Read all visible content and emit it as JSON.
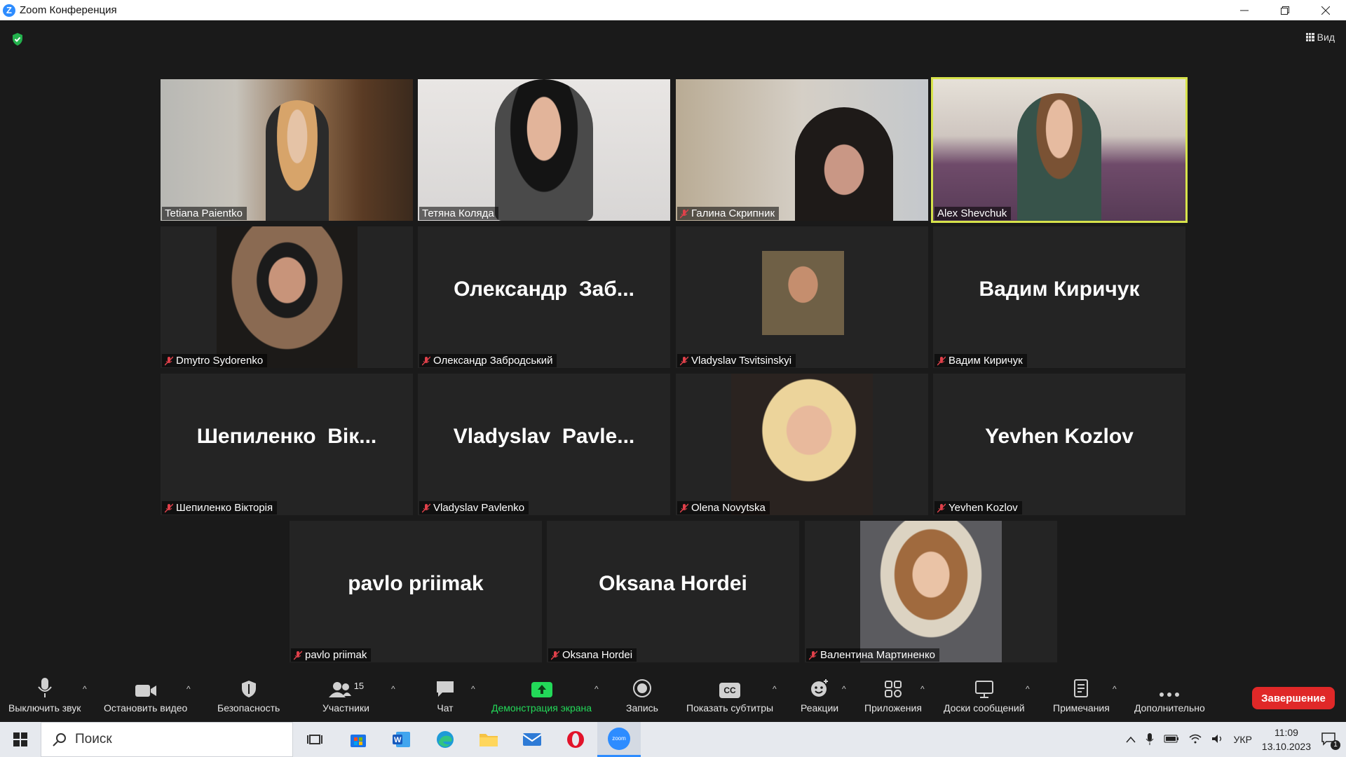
{
  "window": {
    "title": "Zoom Конференция",
    "view_label": "Вид"
  },
  "participants": [
    {
      "name": "Tetiana Paientko",
      "display": "",
      "muted": false,
      "video": true
    },
    {
      "name": "Тетяна Коляда",
      "display": "",
      "muted": false,
      "video": true
    },
    {
      "name": "Галина Скрипник",
      "display": "",
      "muted": true,
      "video": true
    },
    {
      "name": "Alex Shevchuk",
      "display": "",
      "muted": false,
      "video": true,
      "active_speaker": true
    },
    {
      "name": "Dmytro Sydorenko",
      "display": "",
      "muted": true,
      "video": true
    },
    {
      "name": "Олександр Забродський",
      "display": "Олександр  Заб...",
      "muted": true,
      "video": false
    },
    {
      "name": "Vladyslav Tsvitsinskyi",
      "display": "",
      "muted": true,
      "video": true
    },
    {
      "name": "Вадим Киричук",
      "display": "Вадим Киричук",
      "muted": true,
      "video": false
    },
    {
      "name": "Шепиленко Вікторія",
      "display": "Шепиленко  Вік...",
      "muted": true,
      "video": false
    },
    {
      "name": "Vladyslav Pavlenko",
      "display": "Vladyslav  Pavle...",
      "muted": true,
      "video": false
    },
    {
      "name": "Olena Novytska",
      "display": "",
      "muted": true,
      "video": true
    },
    {
      "name": "Yevhen Kozlov",
      "display": "Yevhen Kozlov",
      "muted": true,
      "video": false
    },
    {
      "name": "pavlo priimak",
      "display": "pavlo priimak",
      "muted": true,
      "video": false
    },
    {
      "name": "Oksana Hordei",
      "display": "Oksana Hordei",
      "muted": true,
      "video": false
    },
    {
      "name": "Валентина Мартиненко",
      "display": "",
      "muted": true,
      "video": true
    }
  ],
  "toolbar": {
    "mute": "Выключить звук",
    "stop_video": "Остановить видео",
    "security": "Безопасность",
    "participants": "Участники",
    "participants_count": "15",
    "chat": "Чат",
    "share": "Демонстрация экрана",
    "record": "Запись",
    "captions": "Показать субтитры",
    "captions_icon_text": "CC",
    "reactions": "Реакции",
    "apps": "Приложения",
    "whiteboards": "Доски сообщений",
    "notes": "Примечания",
    "more": "Дополнительно",
    "end": "Завершение"
  },
  "taskbar": {
    "search_placeholder": "Поиск",
    "zoom_label": "zoom",
    "language": "УКР",
    "time": "11:09",
    "date": "13.10.2023",
    "notifications": "1"
  },
  "colors": {
    "share_green": "#23d959",
    "end_red": "#e02828",
    "active_border": "#d7e34b",
    "muted_red": "#e0404a"
  }
}
